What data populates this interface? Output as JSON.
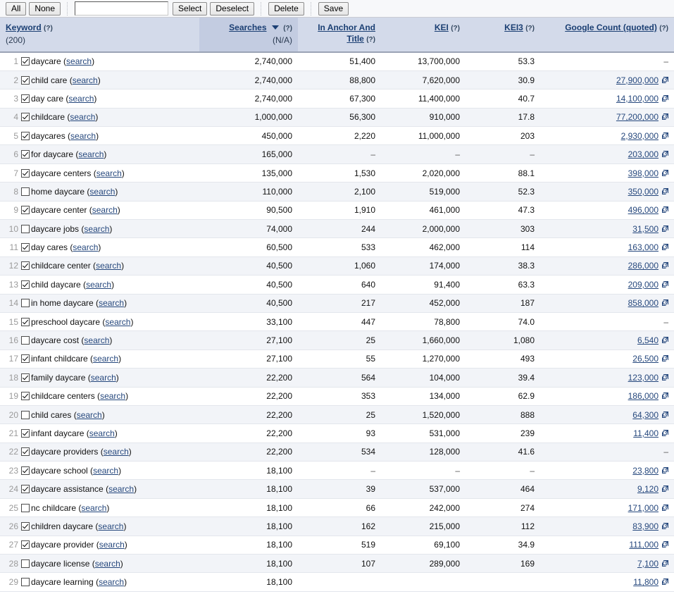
{
  "toolbar": {
    "all_label": "All",
    "none_label": "None",
    "filter_value": "",
    "filter_placeholder": "",
    "select_label": "Select",
    "deselect_label": "Deselect",
    "delete_label": "Delete",
    "save_label": "Save"
  },
  "table": {
    "columns": [
      {
        "key": "keyword",
        "label": "Keyword",
        "help": "?",
        "sub": "(200)",
        "sorted": false
      },
      {
        "key": "searches",
        "label": "Searches",
        "help": "?",
        "sub": "(N/A)",
        "sorted": true,
        "sort_dir": "desc"
      },
      {
        "key": "anchor",
        "label": "In Anchor And Title",
        "help": "?",
        "sub": "",
        "sorted": false
      },
      {
        "key": "kei",
        "label": "KEI",
        "help": "?",
        "sub": "",
        "sorted": false
      },
      {
        "key": "kei3",
        "label": "KEI3",
        "help": "?",
        "sub": "",
        "sorted": false
      },
      {
        "key": "gcount",
        "label": "Google Count (quoted)",
        "help": "?",
        "sub": "",
        "sorted": false
      }
    ],
    "search_link_label": "search",
    "missing_value": "–",
    "rows": [
      {
        "n": "1",
        "checked": true,
        "keyword": "daycare",
        "searches": "2,740,000",
        "anchor": "51,400",
        "kei": "13,700,000",
        "kei3": "53.3",
        "gcount": "–"
      },
      {
        "n": "2",
        "checked": true,
        "keyword": "child care",
        "searches": "2,740,000",
        "anchor": "88,800",
        "kei": "7,620,000",
        "kei3": "30.9",
        "gcount": "27,900,000"
      },
      {
        "n": "3",
        "checked": true,
        "keyword": "day care",
        "searches": "2,740,000",
        "anchor": "67,300",
        "kei": "11,400,000",
        "kei3": "40.7",
        "gcount": "14,100,000"
      },
      {
        "n": "4",
        "checked": true,
        "keyword": "childcare",
        "searches": "1,000,000",
        "anchor": "56,300",
        "kei": "910,000",
        "kei3": "17.8",
        "gcount": "77,200,000"
      },
      {
        "n": "5",
        "checked": true,
        "keyword": "daycares",
        "searches": "450,000",
        "anchor": "2,220",
        "kei": "11,000,000",
        "kei3": "203",
        "gcount": "2,930,000"
      },
      {
        "n": "6",
        "checked": true,
        "keyword": "for daycare",
        "searches": "165,000",
        "anchor": "–",
        "kei": "–",
        "kei3": "–",
        "gcount": "203,000"
      },
      {
        "n": "7",
        "checked": true,
        "keyword": "daycare centers",
        "searches": "135,000",
        "anchor": "1,530",
        "kei": "2,020,000",
        "kei3": "88.1",
        "gcount": "398,000"
      },
      {
        "n": "8",
        "checked": false,
        "keyword": "home daycare",
        "searches": "110,000",
        "anchor": "2,100",
        "kei": "519,000",
        "kei3": "52.3",
        "gcount": "350,000"
      },
      {
        "n": "9",
        "checked": true,
        "keyword": "daycare center",
        "searches": "90,500",
        "anchor": "1,910",
        "kei": "461,000",
        "kei3": "47.3",
        "gcount": "496,000"
      },
      {
        "n": "10",
        "checked": false,
        "keyword": "daycare jobs",
        "searches": "74,000",
        "anchor": "244",
        "kei": "2,000,000",
        "kei3": "303",
        "gcount": "31,500"
      },
      {
        "n": "11",
        "checked": true,
        "keyword": "day cares",
        "searches": "60,500",
        "anchor": "533",
        "kei": "462,000",
        "kei3": "114",
        "gcount": "163,000"
      },
      {
        "n": "12",
        "checked": true,
        "keyword": "childcare center",
        "searches": "40,500",
        "anchor": "1,060",
        "kei": "174,000",
        "kei3": "38.3",
        "gcount": "286,000"
      },
      {
        "n": "13",
        "checked": true,
        "keyword": "child daycare",
        "searches": "40,500",
        "anchor": "640",
        "kei": "91,400",
        "kei3": "63.3",
        "gcount": "209,000"
      },
      {
        "n": "14",
        "checked": false,
        "keyword": "in home daycare",
        "searches": "40,500",
        "anchor": "217",
        "kei": "452,000",
        "kei3": "187",
        "gcount": "858,000"
      },
      {
        "n": "15",
        "checked": true,
        "keyword": "preschool daycare",
        "searches": "33,100",
        "anchor": "447",
        "kei": "78,800",
        "kei3": "74.0",
        "gcount": "–"
      },
      {
        "n": "16",
        "checked": false,
        "keyword": "daycare cost",
        "searches": "27,100",
        "anchor": "25",
        "kei": "1,660,000",
        "kei3": "1,080",
        "gcount": "6,540"
      },
      {
        "n": "17",
        "checked": true,
        "keyword": "infant childcare",
        "searches": "27,100",
        "anchor": "55",
        "kei": "1,270,000",
        "kei3": "493",
        "gcount": "26,500"
      },
      {
        "n": "18",
        "checked": true,
        "keyword": "family daycare",
        "searches": "22,200",
        "anchor": "564",
        "kei": "104,000",
        "kei3": "39.4",
        "gcount": "123,000"
      },
      {
        "n": "19",
        "checked": true,
        "keyword": "childcare centers",
        "searches": "22,200",
        "anchor": "353",
        "kei": "134,000",
        "kei3": "62.9",
        "gcount": "186,000"
      },
      {
        "n": "20",
        "checked": false,
        "keyword": "child cares",
        "searches": "22,200",
        "anchor": "25",
        "kei": "1,520,000",
        "kei3": "888",
        "gcount": "64,300"
      },
      {
        "n": "21",
        "checked": true,
        "keyword": "infant daycare",
        "searches": "22,200",
        "anchor": "93",
        "kei": "531,000",
        "kei3": "239",
        "gcount": "11,400"
      },
      {
        "n": "22",
        "checked": true,
        "keyword": "daycare providers",
        "searches": "22,200",
        "anchor": "534",
        "kei": "128,000",
        "kei3": "41.6",
        "gcount": "–"
      },
      {
        "n": "23",
        "checked": true,
        "keyword": "daycare school",
        "searches": "18,100",
        "anchor": "–",
        "kei": "–",
        "kei3": "–",
        "gcount": "23,800"
      },
      {
        "n": "24",
        "checked": true,
        "keyword": "daycare assistance",
        "searches": "18,100",
        "anchor": "39",
        "kei": "537,000",
        "kei3": "464",
        "gcount": "9,120"
      },
      {
        "n": "25",
        "checked": false,
        "keyword": "nc childcare",
        "searches": "18,100",
        "anchor": "66",
        "kei": "242,000",
        "kei3": "274",
        "gcount": "171,000"
      },
      {
        "n": "26",
        "checked": true,
        "keyword": "children daycare",
        "searches": "18,100",
        "anchor": "162",
        "kei": "215,000",
        "kei3": "112",
        "gcount": "83,900"
      },
      {
        "n": "27",
        "checked": true,
        "keyword": "daycare provider",
        "searches": "18,100",
        "anchor": "519",
        "kei": "69,100",
        "kei3": "34.9",
        "gcount": "111,000"
      },
      {
        "n": "28",
        "checked": false,
        "keyword": "daycare license",
        "searches": "18,100",
        "anchor": "107",
        "kei": "289,000",
        "kei3": "169",
        "gcount": "7,100"
      },
      {
        "n": "29",
        "checked": false,
        "keyword": "daycare learning",
        "searches": "18,100",
        "anchor": "",
        "kei": "",
        "kei3": "",
        "gcount": "11,800"
      }
    ]
  },
  "colors": {
    "header_bg": "#d3daea",
    "sorted_header_bg": "#c3cce1",
    "link": "#26487d",
    "row_alt_bg": "#f2f4f8"
  }
}
